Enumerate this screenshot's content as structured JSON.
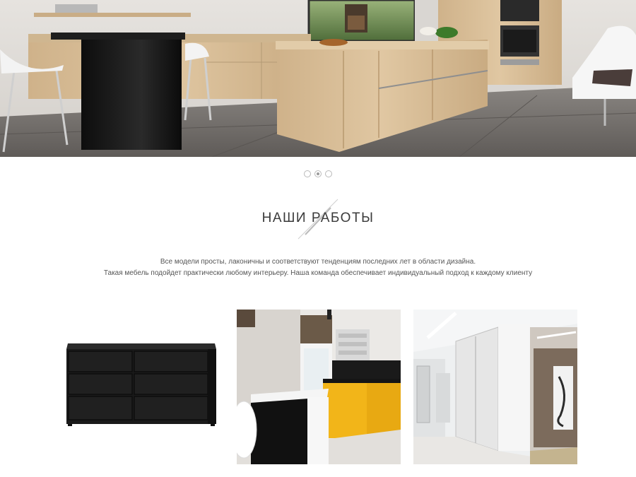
{
  "hero": {
    "slides_count": 3,
    "active_slide": 2
  },
  "works": {
    "title": "НАШИ РАБОТЫ",
    "lead_line1": "Все модели просты, лаконичны и соответствуют тенденциям последних лет в области дизайна.",
    "lead_line2": "Такая мебель подойдет практически любому интерьеру. Наша команда обеспечивает индивидуальный подход к каждому клиенту"
  },
  "gallery": [
    {
      "name": "black-dresser-photo"
    },
    {
      "name": "yellow-kitchen-photo"
    },
    {
      "name": "wardrobe-hallway-photo"
    }
  ],
  "colors": {
    "wood": "#d9bd96",
    "black_gloss": "#141414",
    "yellow": "#f2b519",
    "floor": "#6e6a66"
  }
}
